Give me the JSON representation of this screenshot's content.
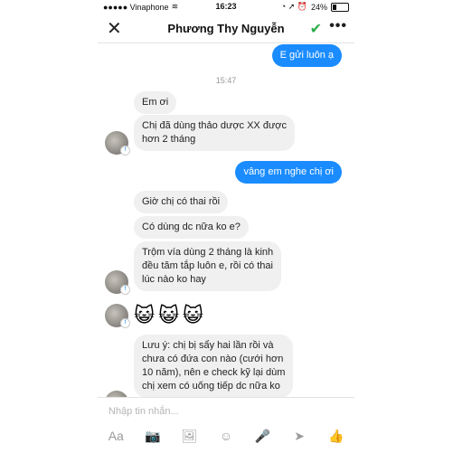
{
  "status_bar": {
    "carrier": "●●●●● Vinaphone",
    "wifi": "≋",
    "time": "16:23",
    "indicators": "◔ ➚ ⏰",
    "battery_text": "24%",
    "battery_level": 0.24
  },
  "header": {
    "close_glyph": "✕",
    "title": "Phương Thy Nguyễn",
    "check_glyph": "✔",
    "more_glyph": "•••"
  },
  "messages": {
    "sent_1": "E gửi luôn ạ",
    "timestamp": "15:47",
    "recv_1": "Em ơi",
    "recv_2": "Chị đã dùng thảo dược XX được\nhơn 2 tháng",
    "sent_2": "vâng em nghe chị ơi",
    "recv_3": "Giờ chị có thai rồi",
    "recv_4": "Có dùng dc nữa ko e?",
    "recv_5": "Trộm vía dùng 2 tháng là kinh\nđều tăm tắp luôn e, rồi có thai\nlúc nào ko hay",
    "emojis": [
      "😺",
      "😺",
      "😺"
    ],
    "recv_6": "Lưu ý: chị bị sẩy hai lần rồi và\nchưa có đứa con nào (cưới hơn\n10 năm), nên e check kỹ lại dùm\nchị xem có uống tiếp dc nữa ko"
  },
  "composer": {
    "placeholder": "Nhập tin nhắn...",
    "tools": [
      {
        "name": "text-format-icon",
        "glyph": "Aa"
      },
      {
        "name": "camera-icon",
        "glyph": "📷"
      },
      {
        "name": "gallery-icon",
        "glyph": "🖼"
      },
      {
        "name": "emoji-icon",
        "glyph": "☺"
      },
      {
        "name": "microphone-icon",
        "glyph": "🎤"
      },
      {
        "name": "location-icon",
        "glyph": "➤"
      },
      {
        "name": "like-icon",
        "glyph": "👍"
      }
    ]
  },
  "colors": {
    "sent_bubble": "#1a8cff",
    "received_bubble": "#f1f0f0",
    "check": "#2dac4a"
  }
}
